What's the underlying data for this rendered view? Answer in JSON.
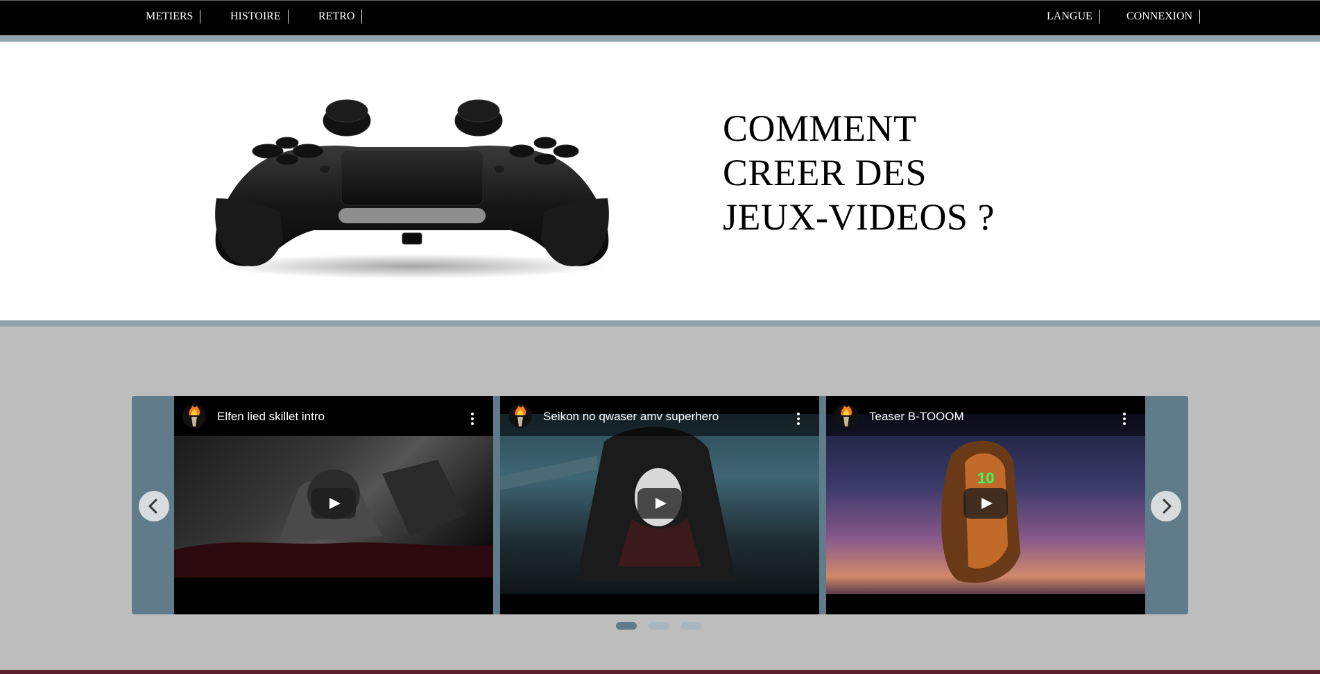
{
  "nav": {
    "left": [
      {
        "label": "METIERS"
      },
      {
        "label": "HISTOIRE"
      },
      {
        "label": "RETRO"
      }
    ],
    "right": [
      {
        "label": "LANGUE"
      },
      {
        "label": "CONNEXION"
      }
    ]
  },
  "hero": {
    "title_line1": "COMMENT",
    "title_line2": "CREER DES",
    "title_line3": "JEUX-VIDEOS ?",
    "image": "gamepad-controller"
  },
  "carousel": {
    "videos": [
      {
        "title": "Elfen lied skillet intro",
        "channel_icon": "torch-icon"
      },
      {
        "title": "Seikon no qwaser amv superhero",
        "channel_icon": "torch-icon"
      },
      {
        "title": "Teaser B-TOOOM",
        "channel_icon": "torch-icon"
      }
    ],
    "prev_icon": "chevron-left-icon",
    "next_icon": "chevron-right-icon",
    "active_dot": 1,
    "dot_count": 3
  },
  "colors": {
    "accent_bar": "#8fa3ad",
    "carousel_bg": "#607b89",
    "page_bg": "#bdbdbd"
  }
}
